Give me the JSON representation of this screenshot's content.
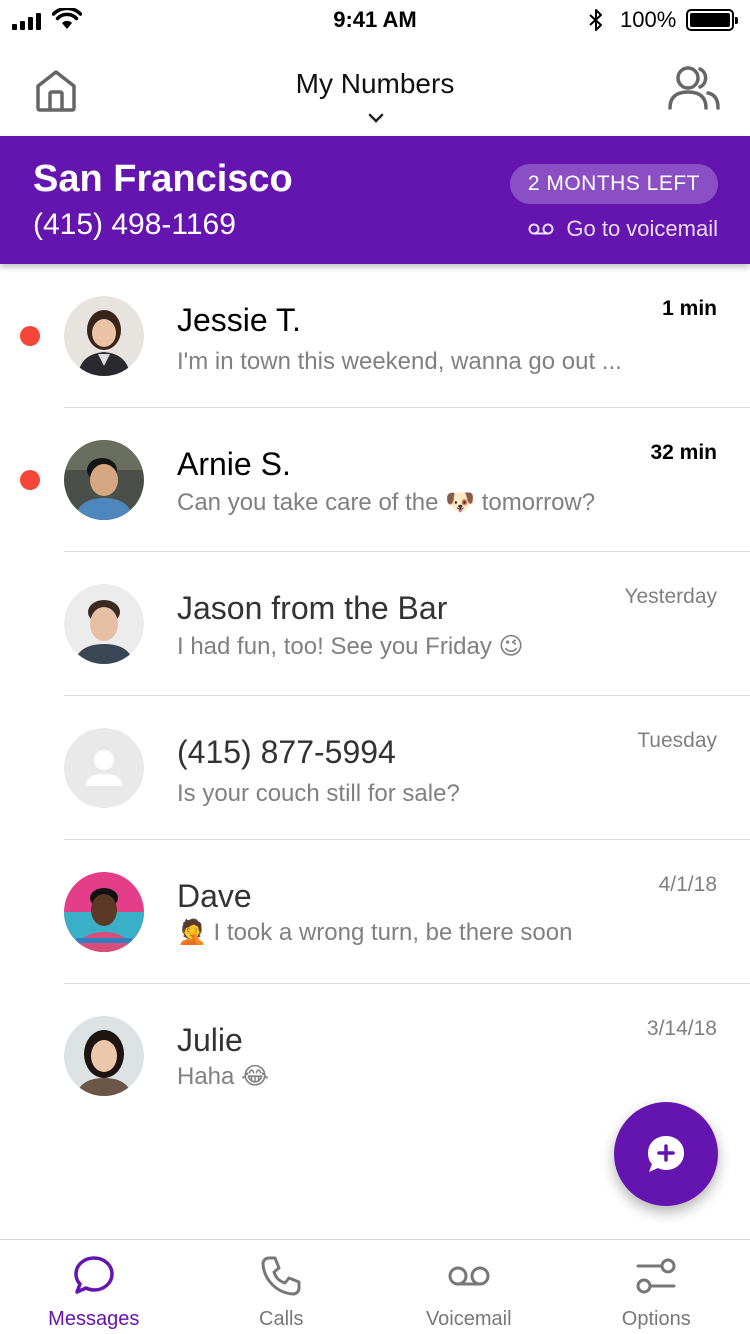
{
  "status_bar": {
    "time": "9:41 AM",
    "battery": "100%"
  },
  "nav": {
    "title": "My Numbers"
  },
  "banner": {
    "city": "San Francisco",
    "phone": "(415) 498-1169",
    "pill": "2 MONTHS LEFT",
    "voicemail_link": "Go to voicemail"
  },
  "conversations": [
    {
      "name": "Jessie T.",
      "preview": "I'm in town this weekend, wanna go out ...",
      "time": "1 min",
      "unread": true
    },
    {
      "name": "Arnie S.",
      "preview_before": "Can you take care of the ",
      "preview_emoji": "🐶",
      "preview_after": " tomorrow?",
      "time": "32 min",
      "unread": true
    },
    {
      "name": "Jason from the Bar",
      "preview_before": "I had fun, too! See you Friday ",
      "preview_emoji": "😉",
      "time": "Yesterday",
      "unread": false
    },
    {
      "name": "(415) 877-5994",
      "preview": "Is your couch still for sale?",
      "time": "Tuesday",
      "unread": false
    },
    {
      "name": "Dave",
      "preview_emoji": "🤦",
      "preview_after": " I took a wrong turn, be there soon",
      "time": "4/1/18",
      "unread": false
    },
    {
      "name": "Julie",
      "preview_before": "Haha ",
      "preview_emoji": "😂",
      "time": "3/14/18",
      "unread": false
    }
  ],
  "tabs": [
    {
      "label": "Messages",
      "icon": "chat-bubble-icon",
      "active": true
    },
    {
      "label": "Calls",
      "icon": "phone-icon",
      "active": false
    },
    {
      "label": "Voicemail",
      "icon": "voicemail-icon",
      "active": false
    },
    {
      "label": "Options",
      "icon": "sliders-icon",
      "active": false
    }
  ],
  "colors": {
    "brand": "#6415b0",
    "unread_dot": "#f4473a"
  }
}
